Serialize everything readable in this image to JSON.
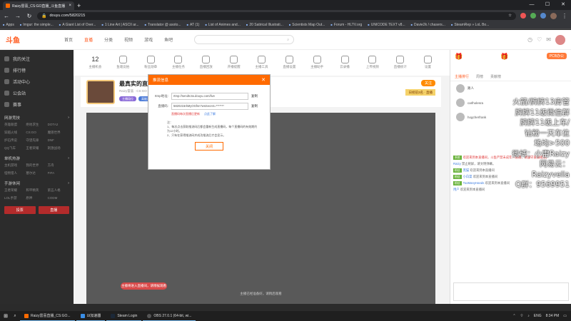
{
  "browser": {
    "tab_title": "Raizy雷喜_CS:GO直播_斗鱼直播",
    "new_tab": "+",
    "win_min": "—",
    "win_max": "☐",
    "win_close": "✕",
    "url": "douyu.com/5820215",
    "bookmarks": [
      "Apps",
      "Imgur: the simple...",
      "A Giant List of Over...",
      "1 Line Art | ASCII ar...",
      "Translator @ asoto...",
      "AT (1)",
      "List of Animes and...",
      "20 Satirical Illustrati...",
      "Scientists Map Out...",
      "Forum - HLTV.org",
      "UNICODE TEXT v8...",
      "Davie2k / chasers...",
      "SteamRep » LoL Bo..."
    ]
  },
  "site": {
    "logo": "斗鱼",
    "nav": [
      "首页",
      "直播",
      "分类",
      "视频",
      "游戏",
      "鱼吧"
    ],
    "nav_active": 1,
    "search_placeholder": ""
  },
  "sidebar": {
    "items": [
      "我的关注",
      "排行榜",
      "活动中心",
      "公会站",
      "赛事"
    ],
    "section1": "网游竞技",
    "section1_grid": [
      "英雄联盟",
      "绝地求生",
      "DOTA2",
      "穿越火线",
      "CS:GO",
      "魔兽世界",
      "炉石传说",
      "守望先锋",
      "DNF",
      "QQ飞车",
      "王者荣耀",
      "刺激战场"
    ],
    "section2": "单机热游",
    "section2_grid": [
      "主机游戏",
      "我的世界",
      "方舟",
      "怪物猎人",
      "塞尔达",
      "FIFA"
    ],
    "section3": "手游休闲",
    "section3_grid": [
      "王者荣耀",
      "和平精英",
      "第五人格",
      "LOL手游",
      "原神",
      "CODM"
    ],
    "btn1": "投票",
    "btn2": "直播"
  },
  "main": {
    "icons": [
      {
        "num": "12",
        "label": "主播机会"
      },
      {
        "num": "",
        "label": "鱼塘竞拍"
      },
      {
        "num": "",
        "label": "粉丝勋章"
      },
      {
        "num": "",
        "label": "主播任务"
      },
      {
        "num": "",
        "label": "直播回放"
      },
      {
        "num": "",
        "label": "开播提醒"
      },
      {
        "num": "",
        "label": "主播工具"
      },
      {
        "num": "",
        "label": "直播设置"
      },
      {
        "num": "",
        "label": "主播助手"
      },
      {
        "num": "",
        "label": "云录播"
      },
      {
        "num": "",
        "label": "上传视频"
      },
      {
        "num": "",
        "label": "直播统计"
      },
      {
        "num": "",
        "label": "设置"
      },
      {
        "num": "",
        "label": "更多"
      }
    ],
    "room_title": "最真实的直播间，半…",
    "room_meta": "Raizy雷喜 · CS:GO · 举报",
    "tag1": "主播段位",
    "tag2": "高能直播",
    "tag3": "超级主播",
    "follow": "关注",
    "award": "日榜前3名 · 直播",
    "player_note": "主播已经准备好，请稍后观看",
    "notify": "主播将进入直播间，请稍候观看"
  },
  "modal": {
    "title": "推流信息",
    "close": "✕",
    "rtmp_label": "rtmp地址:",
    "rtmp_value": "rtmp://sendtc3a.douyu.com/live",
    "rtmp_copy": "复制",
    "code_label": "直播码:",
    "code_value": "5820215rkMyOGfsn?wsSecret=*******",
    "code_copy": "复制",
    "hint": "直播码每次直播后更新",
    "hint_link": "点此了解",
    "notes": "注：\n1、每次点击获取推流码后都会重新生成直播码，每个直播码的有效期约为12小时。\n2、只有在获得推流码并成功推流后才会显示。",
    "button": "关闭"
  },
  "chat": {
    "pcb": "PCB办公",
    "tabs": [
      "主播排行",
      "周榜",
      "贡献榜"
    ],
    "rank_users": [
      "路人",
      "carlholesra",
      "hogcherfrank"
    ],
    "messages": [
      {
        "badge": "系统",
        "text": "欢迎来到本直播间，斗鱼严禁未成年人直播，请遵守直播规范。"
      },
      {
        "badge": "",
        "user": "Raizy",
        "text": "禁止刷屏，请文明弹幕。"
      },
      {
        "badge": "粉丝",
        "user": "黑猫",
        "text": "欢迎来到本直播间"
      },
      {
        "badge": "粉丝",
        "user": "小白菜",
        "text": "欢迎来到本直播间"
      },
      {
        "badge": "粉丝",
        "user": "TooManyHands",
        "text": "欢迎来到本直播间"
      },
      {
        "badge": "",
        "user": "用户",
        "text": "欢迎来到本直播间"
      }
    ]
  },
  "overlay": {
    "lines": [
      "火箭/牌牌13房管",
      "牌牌11级微信群",
      "牌牌11级上车/",
      "钻粉一天车位",
      "场均>500",
      "微博：小雷Raizy",
      "网易云：Raizyvella",
      "Q群：9569951"
    ]
  },
  "taskbar": {
    "apps": [
      "Raizy雷喜直播_CS:GO...",
      "Ui加速器",
      "Steam Login",
      "OBS 27.0.1 (64-bit, wi..."
    ],
    "lang": "ENG",
    "time": "8:34 PM"
  }
}
